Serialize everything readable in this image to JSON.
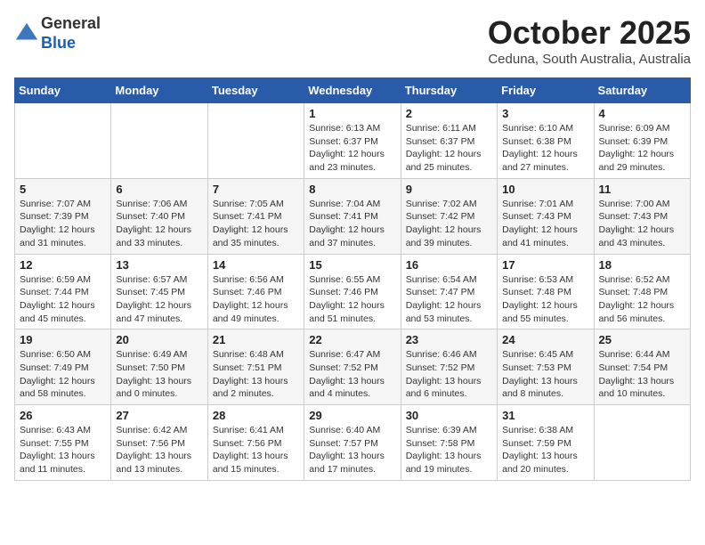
{
  "header": {
    "logo_general": "General",
    "logo_blue": "Blue",
    "month_title": "October 2025",
    "location": "Ceduna, South Australia, Australia"
  },
  "weekdays": [
    "Sunday",
    "Monday",
    "Tuesday",
    "Wednesday",
    "Thursday",
    "Friday",
    "Saturday"
  ],
  "rows": [
    [
      {
        "day": "",
        "info": ""
      },
      {
        "day": "",
        "info": ""
      },
      {
        "day": "",
        "info": ""
      },
      {
        "day": "1",
        "info": "Sunrise: 6:13 AM\nSunset: 6:37 PM\nDaylight: 12 hours\nand 23 minutes."
      },
      {
        "day": "2",
        "info": "Sunrise: 6:11 AM\nSunset: 6:37 PM\nDaylight: 12 hours\nand 25 minutes."
      },
      {
        "day": "3",
        "info": "Sunrise: 6:10 AM\nSunset: 6:38 PM\nDaylight: 12 hours\nand 27 minutes."
      },
      {
        "day": "4",
        "info": "Sunrise: 6:09 AM\nSunset: 6:39 PM\nDaylight: 12 hours\nand 29 minutes."
      }
    ],
    [
      {
        "day": "5",
        "info": "Sunrise: 7:07 AM\nSunset: 7:39 PM\nDaylight: 12 hours\nand 31 minutes."
      },
      {
        "day": "6",
        "info": "Sunrise: 7:06 AM\nSunset: 7:40 PM\nDaylight: 12 hours\nand 33 minutes."
      },
      {
        "day": "7",
        "info": "Sunrise: 7:05 AM\nSunset: 7:41 PM\nDaylight: 12 hours\nand 35 minutes."
      },
      {
        "day": "8",
        "info": "Sunrise: 7:04 AM\nSunset: 7:41 PM\nDaylight: 12 hours\nand 37 minutes."
      },
      {
        "day": "9",
        "info": "Sunrise: 7:02 AM\nSunset: 7:42 PM\nDaylight: 12 hours\nand 39 minutes."
      },
      {
        "day": "10",
        "info": "Sunrise: 7:01 AM\nSunset: 7:43 PM\nDaylight: 12 hours\nand 41 minutes."
      },
      {
        "day": "11",
        "info": "Sunrise: 7:00 AM\nSunset: 7:43 PM\nDaylight: 12 hours\nand 43 minutes."
      }
    ],
    [
      {
        "day": "12",
        "info": "Sunrise: 6:59 AM\nSunset: 7:44 PM\nDaylight: 12 hours\nand 45 minutes."
      },
      {
        "day": "13",
        "info": "Sunrise: 6:57 AM\nSunset: 7:45 PM\nDaylight: 12 hours\nand 47 minutes."
      },
      {
        "day": "14",
        "info": "Sunrise: 6:56 AM\nSunset: 7:46 PM\nDaylight: 12 hours\nand 49 minutes."
      },
      {
        "day": "15",
        "info": "Sunrise: 6:55 AM\nSunset: 7:46 PM\nDaylight: 12 hours\nand 51 minutes."
      },
      {
        "day": "16",
        "info": "Sunrise: 6:54 AM\nSunset: 7:47 PM\nDaylight: 12 hours\nand 53 minutes."
      },
      {
        "day": "17",
        "info": "Sunrise: 6:53 AM\nSunset: 7:48 PM\nDaylight: 12 hours\nand 55 minutes."
      },
      {
        "day": "18",
        "info": "Sunrise: 6:52 AM\nSunset: 7:48 PM\nDaylight: 12 hours\nand 56 minutes."
      }
    ],
    [
      {
        "day": "19",
        "info": "Sunrise: 6:50 AM\nSunset: 7:49 PM\nDaylight: 12 hours\nand 58 minutes."
      },
      {
        "day": "20",
        "info": "Sunrise: 6:49 AM\nSunset: 7:50 PM\nDaylight: 13 hours\nand 0 minutes."
      },
      {
        "day": "21",
        "info": "Sunrise: 6:48 AM\nSunset: 7:51 PM\nDaylight: 13 hours\nand 2 minutes."
      },
      {
        "day": "22",
        "info": "Sunrise: 6:47 AM\nSunset: 7:52 PM\nDaylight: 13 hours\nand 4 minutes."
      },
      {
        "day": "23",
        "info": "Sunrise: 6:46 AM\nSunset: 7:52 PM\nDaylight: 13 hours\nand 6 minutes."
      },
      {
        "day": "24",
        "info": "Sunrise: 6:45 AM\nSunset: 7:53 PM\nDaylight: 13 hours\nand 8 minutes."
      },
      {
        "day": "25",
        "info": "Sunrise: 6:44 AM\nSunset: 7:54 PM\nDaylight: 13 hours\nand 10 minutes."
      }
    ],
    [
      {
        "day": "26",
        "info": "Sunrise: 6:43 AM\nSunset: 7:55 PM\nDaylight: 13 hours\nand 11 minutes."
      },
      {
        "day": "27",
        "info": "Sunrise: 6:42 AM\nSunset: 7:56 PM\nDaylight: 13 hours\nand 13 minutes."
      },
      {
        "day": "28",
        "info": "Sunrise: 6:41 AM\nSunset: 7:56 PM\nDaylight: 13 hours\nand 15 minutes."
      },
      {
        "day": "29",
        "info": "Sunrise: 6:40 AM\nSunset: 7:57 PM\nDaylight: 13 hours\nand 17 minutes."
      },
      {
        "day": "30",
        "info": "Sunrise: 6:39 AM\nSunset: 7:58 PM\nDaylight: 13 hours\nand 19 minutes."
      },
      {
        "day": "31",
        "info": "Sunrise: 6:38 AM\nSunset: 7:59 PM\nDaylight: 13 hours\nand 20 minutes."
      },
      {
        "day": "",
        "info": ""
      }
    ]
  ]
}
